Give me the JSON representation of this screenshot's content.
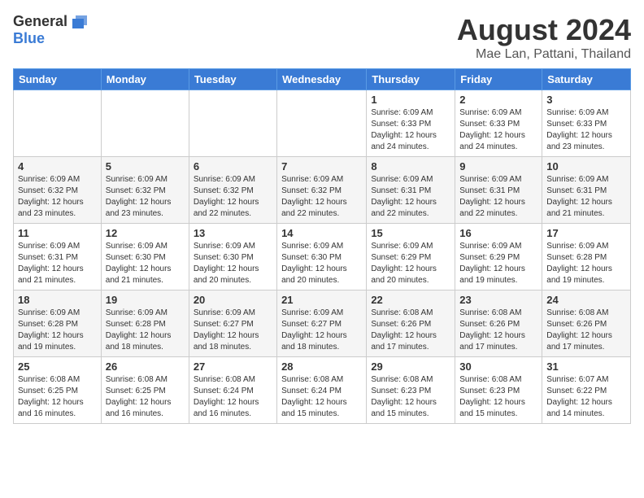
{
  "logo": {
    "general": "General",
    "blue": "Blue"
  },
  "title": "August 2024",
  "location": "Mae Lan, Pattani, Thailand",
  "days_of_week": [
    "Sunday",
    "Monday",
    "Tuesday",
    "Wednesday",
    "Thursday",
    "Friday",
    "Saturday"
  ],
  "weeks": [
    [
      {
        "day": "",
        "info": ""
      },
      {
        "day": "",
        "info": ""
      },
      {
        "day": "",
        "info": ""
      },
      {
        "day": "",
        "info": ""
      },
      {
        "day": "1",
        "info": "Sunrise: 6:09 AM\nSunset: 6:33 PM\nDaylight: 12 hours\nand 24 minutes."
      },
      {
        "day": "2",
        "info": "Sunrise: 6:09 AM\nSunset: 6:33 PM\nDaylight: 12 hours\nand 24 minutes."
      },
      {
        "day": "3",
        "info": "Sunrise: 6:09 AM\nSunset: 6:33 PM\nDaylight: 12 hours\nand 23 minutes."
      }
    ],
    [
      {
        "day": "4",
        "info": "Sunrise: 6:09 AM\nSunset: 6:32 PM\nDaylight: 12 hours\nand 23 minutes."
      },
      {
        "day": "5",
        "info": "Sunrise: 6:09 AM\nSunset: 6:32 PM\nDaylight: 12 hours\nand 23 minutes."
      },
      {
        "day": "6",
        "info": "Sunrise: 6:09 AM\nSunset: 6:32 PM\nDaylight: 12 hours\nand 22 minutes."
      },
      {
        "day": "7",
        "info": "Sunrise: 6:09 AM\nSunset: 6:32 PM\nDaylight: 12 hours\nand 22 minutes."
      },
      {
        "day": "8",
        "info": "Sunrise: 6:09 AM\nSunset: 6:31 PM\nDaylight: 12 hours\nand 22 minutes."
      },
      {
        "day": "9",
        "info": "Sunrise: 6:09 AM\nSunset: 6:31 PM\nDaylight: 12 hours\nand 22 minutes."
      },
      {
        "day": "10",
        "info": "Sunrise: 6:09 AM\nSunset: 6:31 PM\nDaylight: 12 hours\nand 21 minutes."
      }
    ],
    [
      {
        "day": "11",
        "info": "Sunrise: 6:09 AM\nSunset: 6:31 PM\nDaylight: 12 hours\nand 21 minutes."
      },
      {
        "day": "12",
        "info": "Sunrise: 6:09 AM\nSunset: 6:30 PM\nDaylight: 12 hours\nand 21 minutes."
      },
      {
        "day": "13",
        "info": "Sunrise: 6:09 AM\nSunset: 6:30 PM\nDaylight: 12 hours\nand 20 minutes."
      },
      {
        "day": "14",
        "info": "Sunrise: 6:09 AM\nSunset: 6:30 PM\nDaylight: 12 hours\nand 20 minutes."
      },
      {
        "day": "15",
        "info": "Sunrise: 6:09 AM\nSunset: 6:29 PM\nDaylight: 12 hours\nand 20 minutes."
      },
      {
        "day": "16",
        "info": "Sunrise: 6:09 AM\nSunset: 6:29 PM\nDaylight: 12 hours\nand 19 minutes."
      },
      {
        "day": "17",
        "info": "Sunrise: 6:09 AM\nSunset: 6:28 PM\nDaylight: 12 hours\nand 19 minutes."
      }
    ],
    [
      {
        "day": "18",
        "info": "Sunrise: 6:09 AM\nSunset: 6:28 PM\nDaylight: 12 hours\nand 19 minutes."
      },
      {
        "day": "19",
        "info": "Sunrise: 6:09 AM\nSunset: 6:28 PM\nDaylight: 12 hours\nand 18 minutes."
      },
      {
        "day": "20",
        "info": "Sunrise: 6:09 AM\nSunset: 6:27 PM\nDaylight: 12 hours\nand 18 minutes."
      },
      {
        "day": "21",
        "info": "Sunrise: 6:09 AM\nSunset: 6:27 PM\nDaylight: 12 hours\nand 18 minutes."
      },
      {
        "day": "22",
        "info": "Sunrise: 6:08 AM\nSunset: 6:26 PM\nDaylight: 12 hours\nand 17 minutes."
      },
      {
        "day": "23",
        "info": "Sunrise: 6:08 AM\nSunset: 6:26 PM\nDaylight: 12 hours\nand 17 minutes."
      },
      {
        "day": "24",
        "info": "Sunrise: 6:08 AM\nSunset: 6:26 PM\nDaylight: 12 hours\nand 17 minutes."
      }
    ],
    [
      {
        "day": "25",
        "info": "Sunrise: 6:08 AM\nSunset: 6:25 PM\nDaylight: 12 hours\nand 16 minutes."
      },
      {
        "day": "26",
        "info": "Sunrise: 6:08 AM\nSunset: 6:25 PM\nDaylight: 12 hours\nand 16 minutes."
      },
      {
        "day": "27",
        "info": "Sunrise: 6:08 AM\nSunset: 6:24 PM\nDaylight: 12 hours\nand 16 minutes."
      },
      {
        "day": "28",
        "info": "Sunrise: 6:08 AM\nSunset: 6:24 PM\nDaylight: 12 hours\nand 15 minutes."
      },
      {
        "day": "29",
        "info": "Sunrise: 6:08 AM\nSunset: 6:23 PM\nDaylight: 12 hours\nand 15 minutes."
      },
      {
        "day": "30",
        "info": "Sunrise: 6:08 AM\nSunset: 6:23 PM\nDaylight: 12 hours\nand 15 minutes."
      },
      {
        "day": "31",
        "info": "Sunrise: 6:07 AM\nSunset: 6:22 PM\nDaylight: 12 hours\nand 14 minutes."
      }
    ]
  ]
}
